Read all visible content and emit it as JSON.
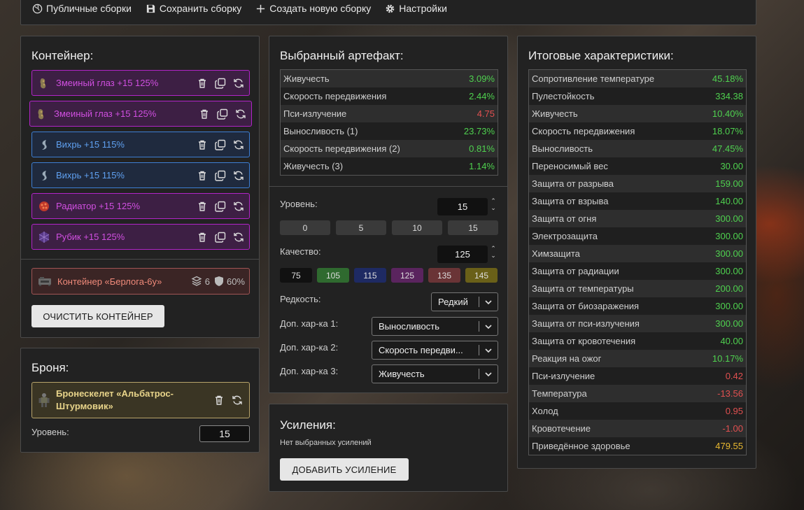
{
  "menu": [
    {
      "label": "Публичные сборки",
      "icon": "globe-icon"
    },
    {
      "label": "Сохранить сборку",
      "icon": "save-icon"
    },
    {
      "label": "Создать новую сборку",
      "icon": "plus-icon"
    },
    {
      "label": "Настройки",
      "icon": "gear-icon"
    }
  ],
  "container": {
    "title": "Контейнер:",
    "artifacts": [
      {
        "name": "Змеиный глаз +15 125%",
        "rarity": "purple",
        "icon": "snake-eye-icon"
      },
      {
        "name": "Змеиный глаз +15 125%",
        "rarity": "purple",
        "icon": "snake-eye-icon"
      },
      {
        "name": "Вихрь +15 115%",
        "rarity": "blue",
        "icon": "whirl-icon"
      },
      {
        "name": "Вихрь +15 115%",
        "rarity": "blue",
        "icon": "whirl-icon"
      },
      {
        "name": "Радиатор +15 125%",
        "rarity": "purple",
        "icon": "radiator-icon"
      },
      {
        "name": "Рубик +15 125%",
        "rarity": "purple",
        "icon": "rubik-icon"
      }
    ],
    "container_item": {
      "name": "Контейнер «Берлога-6у»",
      "slots": "6",
      "protection": "60%"
    },
    "clear_label": "ОЧИСТИТЬ КОНТЕЙНЕР"
  },
  "armor": {
    "title": "Броня:",
    "name": "Бронескелет «Альбатрос-Штурмовик»",
    "level_label": "Уровень:",
    "level_value": "15"
  },
  "artifact": {
    "title": "Выбранный артефакт:",
    "stats": [
      {
        "name": "Живучесть",
        "value": "3.09%",
        "tone": "pos"
      },
      {
        "name": "Скорость передвижения",
        "value": "2.44%",
        "tone": "pos"
      },
      {
        "name": "Пси-излучение",
        "value": "4.75",
        "tone": "neg"
      },
      {
        "name": "Выносливость (1)",
        "value": "23.73%",
        "tone": "pos"
      },
      {
        "name": "Скорость передвижения (2)",
        "value": "0.81%",
        "tone": "pos"
      },
      {
        "name": "Живучесть (3)",
        "value": "1.14%",
        "tone": "pos"
      }
    ],
    "level_label": "Уровень:",
    "level_value": "15",
    "level_presets": [
      "0",
      "5",
      "10",
      "15"
    ],
    "quality_label": "Качество:",
    "quality_value": "125",
    "quality_presets": [
      {
        "label": "75",
        "color": "#111111"
      },
      {
        "label": "105",
        "color": "#2f6a2f"
      },
      {
        "label": "115",
        "color": "#1e2a63"
      },
      {
        "label": "125",
        "color": "#5a245e"
      },
      {
        "label": "135",
        "color": "#6a3436"
      },
      {
        "label": "145",
        "color": "#6a6018"
      }
    ],
    "rarity_label": "Редкость:",
    "rarity_value": "Редкий",
    "extra1_label": "Доп. хар-ка 1:",
    "extra1_value": "Выносливость",
    "extra2_label": "Доп. хар-ка 2:",
    "extra2_value": "Скорость передви...",
    "extra3_label": "Доп. хар-ка 3:",
    "extra3_value": "Живучесть"
  },
  "boosts": {
    "title": "Усиления:",
    "empty_text": "Нет выбранных усилений",
    "add_label": "ДОБАВИТЬ УСИЛЕНИЕ"
  },
  "totals": {
    "title": "Итоговые характеристики:",
    "stats": [
      {
        "name": "Сопротивление температуре",
        "value": "45.18%",
        "tone": "pos"
      },
      {
        "name": "Пулестойкость",
        "value": "334.38",
        "tone": "pos"
      },
      {
        "name": "Живучесть",
        "value": "10.40%",
        "tone": "pos"
      },
      {
        "name": "Скорость передвижения",
        "value": "18.07%",
        "tone": "pos"
      },
      {
        "name": "Выносливость",
        "value": "47.45%",
        "tone": "pos"
      },
      {
        "name": "Переносимый вес",
        "value": "30.00",
        "tone": "pos"
      },
      {
        "name": "Защита от разрыва",
        "value": "159.00",
        "tone": "pos"
      },
      {
        "name": "Защита от взрыва",
        "value": "140.00",
        "tone": "pos"
      },
      {
        "name": "Защита от огня",
        "value": "300.00",
        "tone": "pos"
      },
      {
        "name": "Электрозащита",
        "value": "300.00",
        "tone": "pos"
      },
      {
        "name": "Химзащита",
        "value": "300.00",
        "tone": "pos"
      },
      {
        "name": "Защита от радиации",
        "value": "300.00",
        "tone": "pos"
      },
      {
        "name": "Защита от температуры",
        "value": "200.00",
        "tone": "pos"
      },
      {
        "name": "Защита от биозаражения",
        "value": "300.00",
        "tone": "pos"
      },
      {
        "name": "Защита от пси-излучения",
        "value": "300.00",
        "tone": "pos"
      },
      {
        "name": "Защита от кровотечения",
        "value": "40.00",
        "tone": "pos"
      },
      {
        "name": "Реакция на ожог",
        "value": "10.17%",
        "tone": "pos"
      },
      {
        "name": "Пси-излучение",
        "value": "0.42",
        "tone": "neg"
      },
      {
        "name": "Температура",
        "value": "-13.56",
        "tone": "neg"
      },
      {
        "name": "Холод",
        "value": "0.95",
        "tone": "neg"
      },
      {
        "name": "Кровотечение",
        "value": "-1.00",
        "tone": "neg"
      },
      {
        "name": "Приведённое здоровье",
        "value": "479.55",
        "tone": "gold"
      }
    ]
  }
}
